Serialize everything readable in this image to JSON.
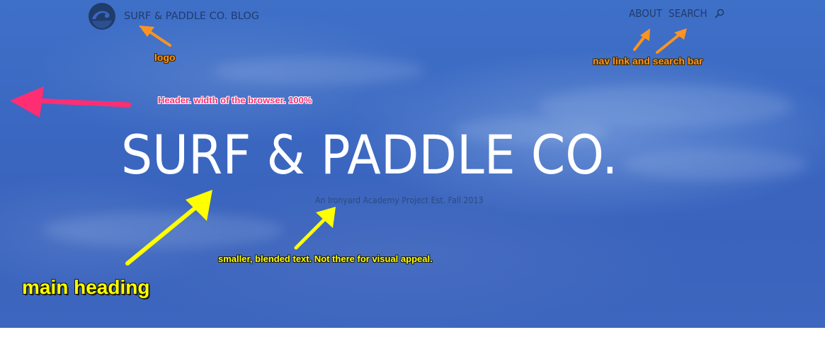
{
  "header": {
    "logo": {
      "icon": "wave-icon",
      "text": "SURF & PADDLE CO. BLOG"
    },
    "nav": {
      "about_label": "ABOUT",
      "search_label": "SEARCH",
      "search_icon": "search-icon"
    }
  },
  "hero": {
    "title": "SURF & PADDLE CO.",
    "subtitle": "An Ironyard Academy Project Est. Fall 2013"
  },
  "annotations": {
    "logo": "logo",
    "nav": "nav link and search bar",
    "header": "Header. width of the browser. 100%",
    "main_heading": "main heading",
    "subtitle": "smaller, blended text. Not there for visual appeal."
  },
  "colors": {
    "hero_blue": "#3a67c1",
    "header_text": "#1f3c6c",
    "annotation_orange": "#ff9320",
    "annotation_pink": "#ff2e72",
    "annotation_yellow": "#ffff00"
  }
}
